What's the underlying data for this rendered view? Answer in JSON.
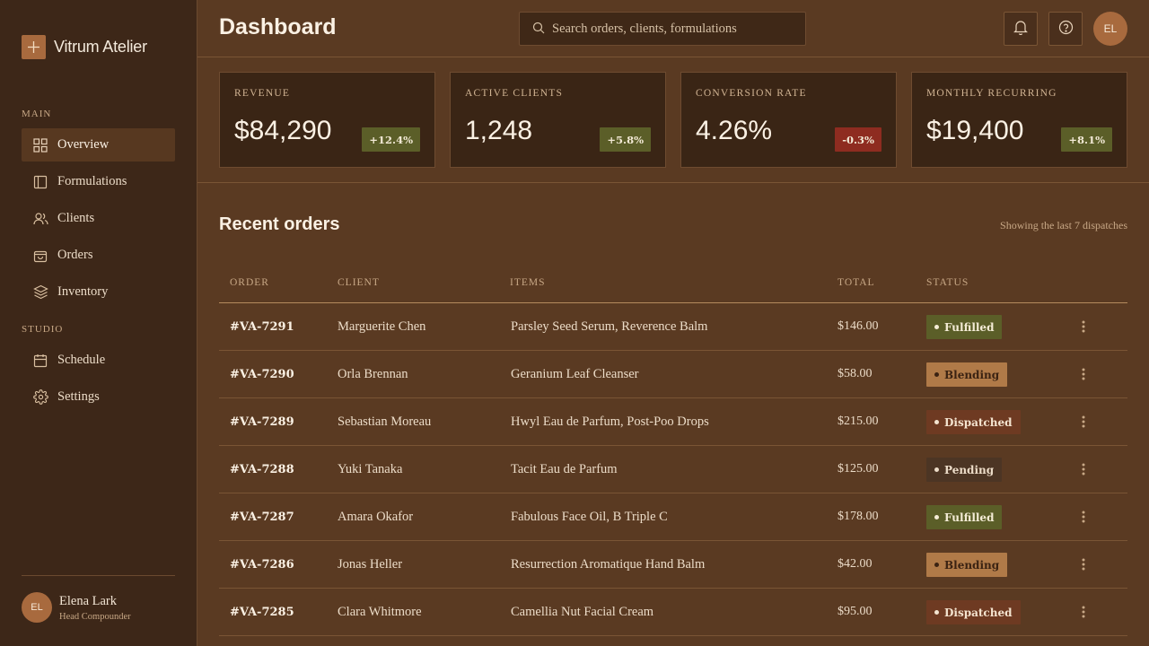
{
  "app": {
    "name": "Vitrum Atelier"
  },
  "sidebar": {
    "sections": [
      {
        "label": "MAIN"
      },
      {
        "label": "STUDIO"
      }
    ],
    "items": [
      {
        "label": "Overview",
        "icon": "grid-icon",
        "active": true
      },
      {
        "label": "Formulations",
        "icon": "book-icon"
      },
      {
        "label": "Clients",
        "icon": "users-icon"
      },
      {
        "label": "Orders",
        "icon": "bag-icon"
      },
      {
        "label": "Inventory",
        "icon": "layers-icon"
      },
      {
        "label": "Schedule",
        "icon": "calendar-icon"
      },
      {
        "label": "Settings",
        "icon": "gear-icon"
      }
    ],
    "user": {
      "initials": "EL",
      "name": "Elena Lark",
      "role": "Head Compounder"
    }
  },
  "header": {
    "title": "Dashboard",
    "search_placeholder": "Search orders, clients, formulations",
    "avatar_initials": "EL"
  },
  "kpis": [
    {
      "label": "REVENUE",
      "value": "$84,290",
      "delta": "+12.4%",
      "trend": "up"
    },
    {
      "label": "ACTIVE CLIENTS",
      "value": "1,248",
      "delta": "+5.8%",
      "trend": "up"
    },
    {
      "label": "CONVERSION RATE",
      "value": "4.26%",
      "delta": "-0.3%",
      "trend": "down"
    },
    {
      "label": "MONTHLY RECURRING",
      "value": "$19,400",
      "delta": "+8.1%",
      "trend": "up"
    }
  ],
  "orders": {
    "title": "Recent orders",
    "subtitle": "Showing the last 7 dispatches",
    "columns": [
      "ORDER",
      "CLIENT",
      "ITEMS",
      "TOTAL",
      "STATUS"
    ],
    "rows": [
      {
        "order": "#VA-7291",
        "client": "Marguerite Chen",
        "items": "Parsley Seed Serum, Reverence Balm",
        "total": "$146.00",
        "status": "Fulfilled"
      },
      {
        "order": "#VA-7290",
        "client": "Orla Brennan",
        "items": "Geranium Leaf Cleanser",
        "total": "$58.00",
        "status": "Blending"
      },
      {
        "order": "#VA-7289",
        "client": "Sebastian Moreau",
        "items": "Hwyl Eau de Parfum, Post-Poo Drops",
        "total": "$215.00",
        "status": "Dispatched"
      },
      {
        "order": "#VA-7288",
        "client": "Yuki Tanaka",
        "items": "Tacit Eau de Parfum",
        "total": "$125.00",
        "status": "Pending"
      },
      {
        "order": "#VA-7287",
        "client": "Amara Okafor",
        "items": "Fabulous Face Oil, B Triple C",
        "total": "$178.00",
        "status": "Fulfilled"
      },
      {
        "order": "#VA-7286",
        "client": "Jonas Heller",
        "items": "Resurrection Aromatique Hand Balm",
        "total": "$42.00",
        "status": "Blending"
      },
      {
        "order": "#VA-7285",
        "client": "Clara Whitmore",
        "items": "Camellia Nut Facial Cream",
        "total": "$95.00",
        "status": "Dispatched"
      }
    ]
  },
  "colors": {
    "background": "#5a3a22",
    "sidebar": "#3d2718",
    "accent": "#a86a3e",
    "positive": "#5b5e28",
    "negative": "#8e2c20"
  }
}
